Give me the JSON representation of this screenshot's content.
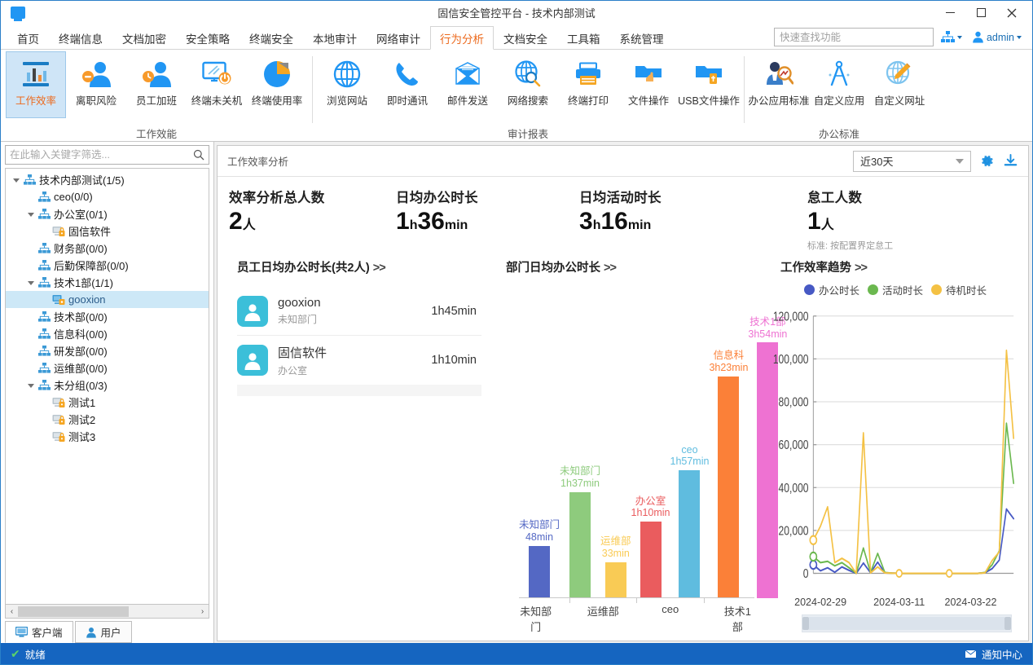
{
  "window": {
    "title": "固信安全管控平台 - 技术内部测试",
    "logo_icon": "monitor-icon",
    "minimize_label": "—",
    "maximize_label": "□",
    "close_label": "✕"
  },
  "menubar": {
    "items": [
      {
        "label": "首页",
        "active": false
      },
      {
        "label": "终端信息",
        "active": false
      },
      {
        "label": "文档加密",
        "active": false
      },
      {
        "label": "安全策略",
        "active": false
      },
      {
        "label": "终端安全",
        "active": false
      },
      {
        "label": "本地审计",
        "active": false
      },
      {
        "label": "网络审计",
        "active": false
      },
      {
        "label": "行为分析",
        "active": true
      },
      {
        "label": "文档安全",
        "active": false
      },
      {
        "label": "工具箱",
        "active": false
      },
      {
        "label": "系统管理",
        "active": false
      }
    ],
    "search_placeholder": "快速查找功能",
    "search_value": "",
    "org_icon": "org-tree-icon",
    "user_icon": "user-icon",
    "user_label": "admin"
  },
  "ribbon": {
    "groups": [
      {
        "title": "工作效能",
        "buttons": [
          {
            "label": "工作效率",
            "icon": "bar-chart-icon",
            "active": true
          },
          {
            "label": "离职风险",
            "icon": "user-minus-icon",
            "active": false
          },
          {
            "label": "员工加班",
            "icon": "user-clock-icon",
            "active": false
          },
          {
            "label": "终端未关机",
            "icon": "monitor-power-icon",
            "active": false
          },
          {
            "label": "终端使用率",
            "icon": "pie-chart-icon",
            "active": false
          }
        ]
      },
      {
        "title": "审计报表",
        "buttons": [
          {
            "label": "浏览网站",
            "icon": "globe-icon",
            "active": false
          },
          {
            "label": "即时通讯",
            "icon": "phone-icon",
            "active": false
          },
          {
            "label": "邮件发送",
            "icon": "mail-icon",
            "active": false
          },
          {
            "label": "网络搜索",
            "icon": "globe-search-icon",
            "active": false
          },
          {
            "label": "终端打印",
            "icon": "printer-icon",
            "active": false
          },
          {
            "label": "文件操作",
            "icon": "folder-hand-icon",
            "active": false
          },
          {
            "label": "USB文件操作",
            "icon": "folder-usb-icon",
            "active": false
          }
        ]
      },
      {
        "title": "办公标准",
        "buttons": [
          {
            "label": "办公应用标准",
            "icon": "user-search-icon",
            "active": false
          },
          {
            "label": "自定义应用",
            "icon": "compass-icon",
            "active": false
          },
          {
            "label": "自定义网址",
            "icon": "globe-pencil-icon",
            "active": false
          }
        ]
      }
    ]
  },
  "sidebar": {
    "filter_placeholder": "在此输入关键字筛选...",
    "filter_value": "",
    "search_icon": "search-icon",
    "tree": [
      {
        "label": "技术内部测试(1/5)",
        "depth": 0,
        "icon": "org-icon",
        "expander": "down",
        "selected": false
      },
      {
        "label": "ceo(0/0)",
        "depth": 1,
        "icon": "org-icon",
        "expander": "none",
        "selected": false
      },
      {
        "label": "办公室(0/1)",
        "depth": 1,
        "icon": "org-icon",
        "expander": "down",
        "selected": false
      },
      {
        "label": "固信软件",
        "depth": 2,
        "icon": "computer-lock-icon",
        "expander": "none",
        "selected": false
      },
      {
        "label": "财务部(0/0)",
        "depth": 1,
        "icon": "org-icon",
        "expander": "none",
        "selected": false
      },
      {
        "label": "后勤保障部(0/0)",
        "depth": 1,
        "icon": "org-icon",
        "expander": "none",
        "selected": false
      },
      {
        "label": "技术1部(1/1)",
        "depth": 1,
        "icon": "org-icon",
        "expander": "down",
        "selected": false
      },
      {
        "label": "gooxion",
        "depth": 2,
        "icon": "computer-online-icon",
        "expander": "none",
        "selected": true
      },
      {
        "label": "技术部(0/0)",
        "depth": 1,
        "icon": "org-icon",
        "expander": "none",
        "selected": false
      },
      {
        "label": "信息科(0/0)",
        "depth": 1,
        "icon": "org-icon",
        "expander": "none",
        "selected": false
      },
      {
        "label": "研发部(0/0)",
        "depth": 1,
        "icon": "org-icon",
        "expander": "none",
        "selected": false
      },
      {
        "label": "运维部(0/0)",
        "depth": 1,
        "icon": "org-icon",
        "expander": "none",
        "selected": false
      },
      {
        "label": "未分组(0/3)",
        "depth": 1,
        "icon": "org-icon",
        "expander": "down",
        "selected": false
      },
      {
        "label": "测试1",
        "depth": 2,
        "icon": "computer-lock-icon",
        "expander": "none",
        "selected": false
      },
      {
        "label": "测试2",
        "depth": 2,
        "icon": "computer-lock-icon",
        "expander": "none",
        "selected": false
      },
      {
        "label": "测试3",
        "depth": 2,
        "icon": "computer-lock-icon",
        "expander": "none",
        "selected": false
      }
    ],
    "scroll_left_label": "‹",
    "scroll_right_label": "›",
    "tabs": [
      {
        "label": "客户端",
        "icon": "monitor-icon",
        "active": true
      },
      {
        "label": "用户",
        "icon": "user-icon",
        "active": false
      }
    ]
  },
  "content": {
    "header_title": "工作效率分析",
    "date_range": "近30天",
    "settings_icon": "gear-icon",
    "export_icon": "download-icon",
    "kpis": [
      {
        "label": "效率分析总人数",
        "value": "2",
        "unit": "人",
        "sub": ""
      },
      {
        "label": "日均办公时长",
        "value": "1",
        "unit": "h",
        "value2": "36",
        "unit2": "min",
        "sub": ""
      },
      {
        "label": "日均活动时长",
        "value": "3",
        "unit": "h",
        "value2": "16",
        "unit2": "min",
        "sub": ""
      },
      {
        "label": "怠工人数",
        "value": "1",
        "unit": "人",
        "sub": "标准: 按配置界定怠工"
      }
    ],
    "employee_panel": {
      "title": "员工日均办公时长(共2人)",
      "more": ">>",
      "rows": [
        {
          "name": "gooxion",
          "dept": "未知部门",
          "time": "1h45min",
          "avatar_icon": "avatar-icon"
        },
        {
          "name": "固信软件",
          "dept": "办公室",
          "time": "1h10min",
          "avatar_icon": "avatar-icon"
        }
      ]
    },
    "dept_panel": {
      "title": "部门日均办公时长",
      "more": ">>"
    },
    "trend_panel": {
      "title": "工作效率趋势",
      "more": ">>"
    }
  },
  "chart_data": [
    {
      "type": "bar",
      "title": "部门日均办公时长",
      "xlabel": "",
      "ylabel": "",
      "ylim": [
        0,
        240
      ],
      "grid": false,
      "categories": [
        "未知部门",
        "未知部门",
        "运维部",
        "办公室",
        "ceo",
        "信息科",
        "技术1部"
      ],
      "tick_labels": [
        "未知部门",
        "",
        "运维部",
        "",
        "ceo",
        "",
        "技术1部"
      ],
      "data_labels": [
        "48min",
        "1h37min",
        "33min",
        "1h10min",
        "1h57min",
        "3h23min",
        "3h54min"
      ],
      "values": [
        48,
        97,
        33,
        70,
        117,
        203,
        234
      ],
      "unit": "minutes",
      "colors": [
        "#5468c4",
        "#8ecb7d",
        "#f9cb55",
        "#ea5c5e",
        "#5fbcdf",
        "#fb8038",
        "#ee72d2"
      ]
    },
    {
      "type": "line",
      "title": "工作效率趋势",
      "xlabel": "",
      "ylabel": "",
      "ylim": [
        0,
        120000
      ],
      "yticks": [
        "0",
        "20,000",
        "40,000",
        "60,000",
        "80,000",
        "100,000",
        "120,000"
      ],
      "grid": true,
      "legend_position": "top",
      "x_tick_labels": [
        "2024-02-29",
        "2024-03-11",
        "2024-03-22"
      ],
      "series": [
        {
          "name": "办公时长",
          "color": "#4759c4",
          "values": [
            4000,
            1200,
            2600,
            500,
            3000,
            1400,
            0,
            4800,
            300,
            5200,
            200,
            100,
            0,
            0,
            0,
            0,
            0,
            0,
            0,
            0,
            0,
            0,
            0,
            0,
            300,
            2200,
            6200,
            30000,
            25500
          ]
        },
        {
          "name": "活动时长",
          "color": "#6bb84f",
          "values": [
            7800,
            5000,
            5600,
            3500,
            5000,
            2600,
            0,
            11800,
            400,
            9300,
            400,
            100,
            0,
            0,
            0,
            0,
            0,
            0,
            0,
            0,
            0,
            0,
            0,
            0,
            400,
            4000,
            10500,
            70000,
            42000
          ]
        },
        {
          "name": "待机时长",
          "color": "#f4c144",
          "values": [
            15500,
            22000,
            31000,
            5000,
            7000,
            5000,
            0,
            65500,
            200,
            3000,
            200,
            100,
            0,
            0,
            0,
            0,
            0,
            0,
            0,
            0,
            0,
            0,
            0,
            0,
            200,
            6000,
            10000,
            104000,
            63000
          ]
        }
      ]
    }
  ],
  "statusbar": {
    "status_icon": "check-icon",
    "status_text": "就绪",
    "notify_icon": "mail-icon",
    "notify_text": "通知中心"
  }
}
